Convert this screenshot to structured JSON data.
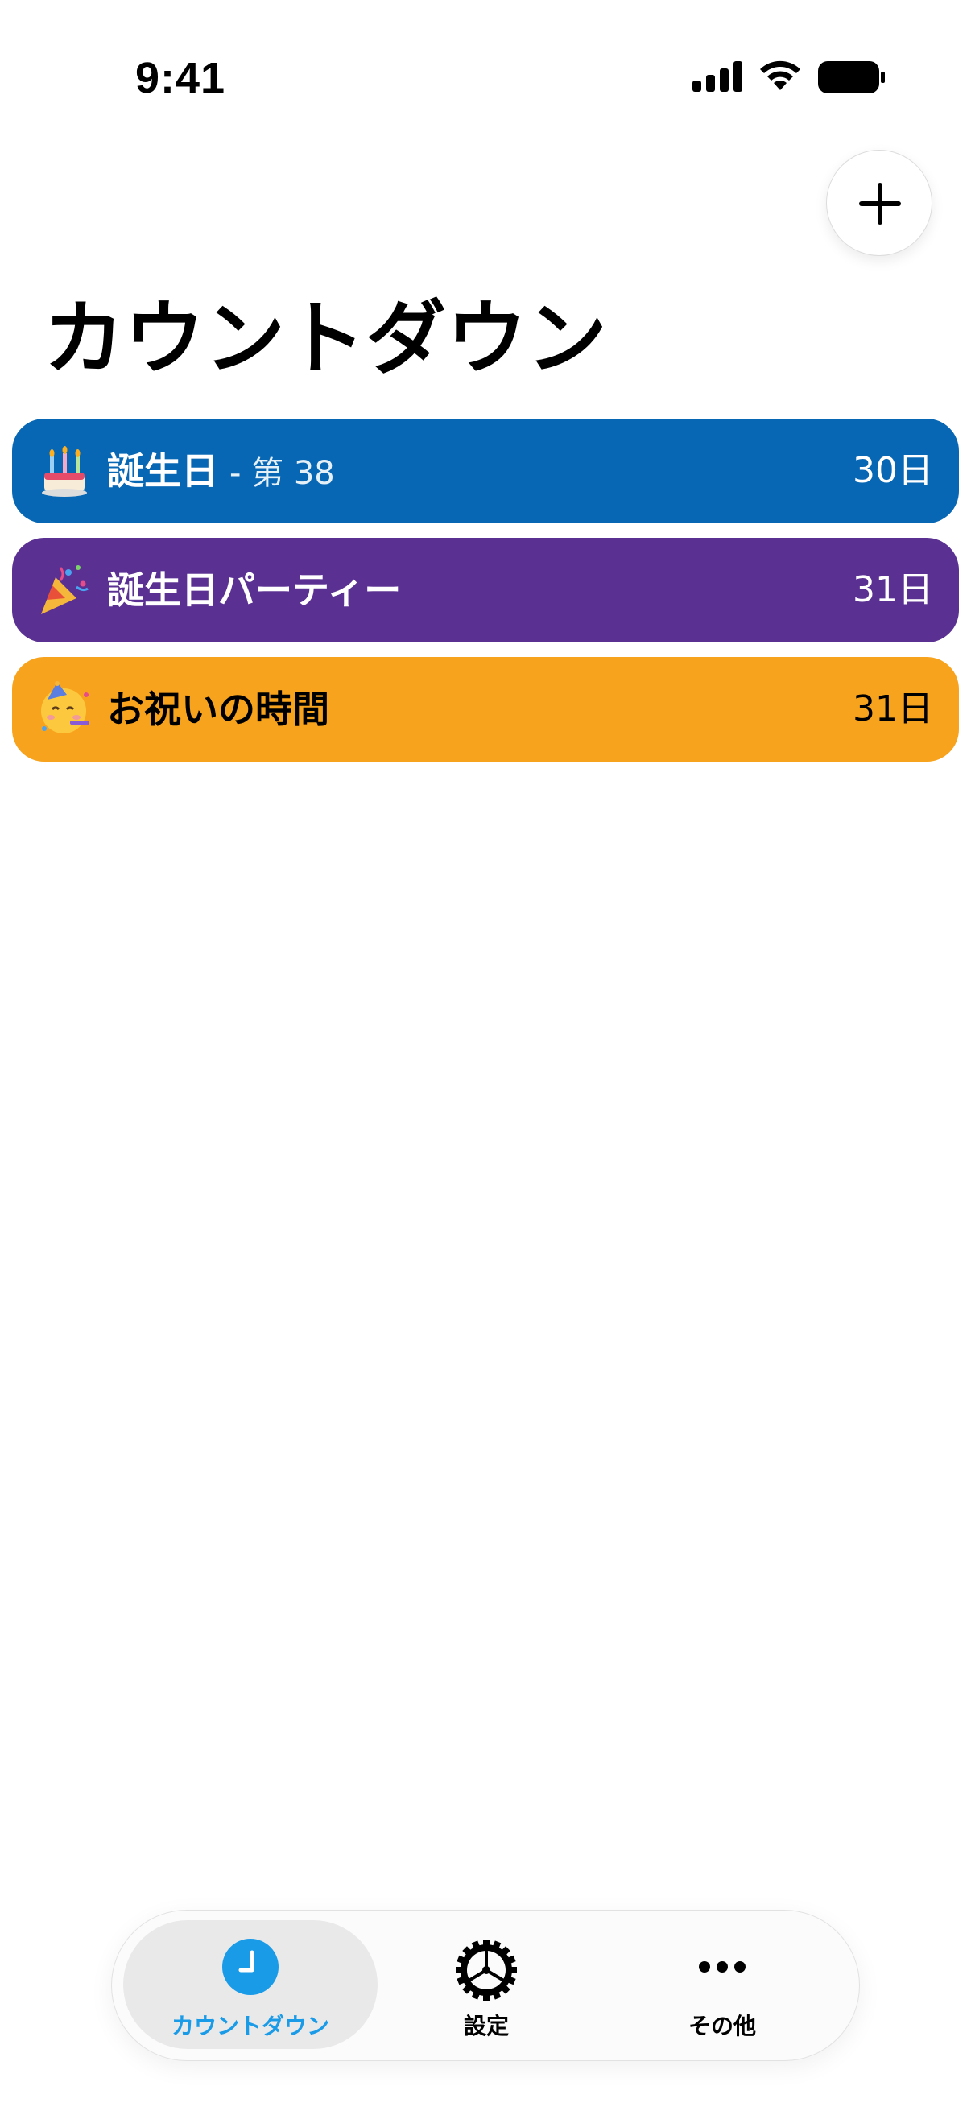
{
  "status_bar": {
    "time": "9:41"
  },
  "header": {
    "title": "カウントダウン",
    "add_button_icon": "plus-icon"
  },
  "countdowns": [
    {
      "emoji": "birthday-cake",
      "title": "誕生日",
      "subtitle": "- 第 38",
      "days": "30日",
      "color": "#0767B4",
      "text_color": "#ffffff"
    },
    {
      "emoji": "party-popper",
      "title": "誕生日パーティー",
      "subtitle": "",
      "days": "31日",
      "color": "#5A3092",
      "text_color": "#ffffff"
    },
    {
      "emoji": "partying-face",
      "title": "お祝いの時間",
      "subtitle": "",
      "days": "31日",
      "color": "#F8A31E",
      "text_color": "#000000"
    }
  ],
  "tab_bar": {
    "tabs": [
      {
        "label": "カウントダウン",
        "icon": "clock-icon",
        "active": true,
        "color": "#1A9BE8"
      },
      {
        "label": "設定",
        "icon": "gear-icon",
        "active": false,
        "color": "#000000"
      },
      {
        "label": "その他",
        "icon": "more-icon",
        "active": false,
        "color": "#000000"
      }
    ]
  }
}
